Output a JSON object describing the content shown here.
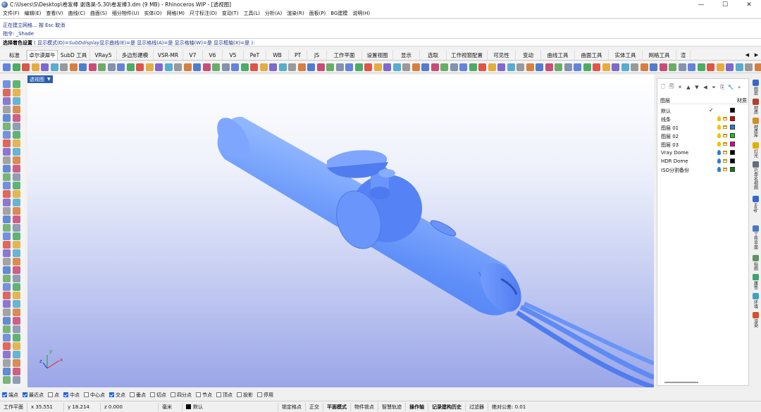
{
  "window": {
    "title": "C:\\Users\\S\\Desktop\\卷发棒 谢逸昊-5.30\\卷发棒3.dm (9 MB) - Rhinoceros WIP - [透视图]",
    "minimize": "—",
    "maximize": "☐",
    "close": "✕"
  },
  "menu": [
    "文件(F)",
    "编辑(E)",
    "查看(V)",
    "曲线(C)",
    "曲面(S)",
    "细分物件(U)",
    "实体(O)",
    "网格(M)",
    "尺寸标注(D)",
    "变动(T)",
    "工具(L)",
    "分析(A)",
    "渲染(R)",
    "面板(P)",
    "BG建模",
    "说明(H)"
  ],
  "command": {
    "history1": "正在建立网格... 按 Esc 取消",
    "history2": "指令: _Shade",
    "prompt_label": "选择着色设置",
    "prompt_opts_a": "( 显示模式(D)=",
    "prompt_mode": "SubDdisplay",
    "prompt_opts_b": " 显示曲线(E)=是 显示格线(A)=是 显示格轴(W)=是 显示框轴(X)=是 ):"
  },
  "tabs": [
    {
      "label": "标准",
      "w": 34
    },
    {
      "label": "卓尔谟犀牛",
      "w": 44,
      "active": true
    },
    {
      "label": "SubD 工具",
      "w": 46
    },
    {
      "label": "VRay5",
      "w": 38
    },
    {
      "label": "多边形建模",
      "w": 52
    },
    {
      "label": "VSR-MR",
      "w": 42
    },
    {
      "label": "V7",
      "w": 28
    },
    {
      "label": "V6",
      "w": 28
    },
    {
      "label": "V5",
      "w": 30
    },
    {
      "label": "PeT",
      "w": 32
    },
    {
      "label": "WB",
      "w": 32
    },
    {
      "label": "PT",
      "w": 26
    },
    {
      "label": "JS",
      "w": 28
    },
    {
      "label": "工作平面",
      "w": 50
    },
    {
      "label": "设置视图",
      "w": 44
    },
    {
      "label": "显示",
      "w": 38
    },
    {
      "label": "选取",
      "w": 38
    },
    {
      "label": "工作视窗配置",
      "w": 58
    },
    {
      "label": "可见性",
      "w": 40
    },
    {
      "label": "变动",
      "w": 36
    },
    {
      "label": "曲线工具",
      "w": 48
    },
    {
      "label": "曲面工具",
      "w": 48
    },
    {
      "label": "实体工具",
      "w": 48
    },
    {
      "label": "网格工具",
      "w": 48
    },
    {
      "label": "渲",
      "w": 20
    }
  ],
  "tab_scroll": {
    "left": "◀",
    "right": "▶"
  },
  "viewport": {
    "label": "透视图",
    "axis_x": "x",
    "axis_y": "y",
    "axis_z": "z"
  },
  "layers_panel": {
    "icons": [
      "🗋",
      "🗐",
      "✕",
      "▲",
      "▼",
      "◀",
      "⏷",
      "⎘",
      "🔧",
      "»"
    ],
    "col_layer": "图层",
    "col_material": "材质",
    "layers": [
      {
        "name": "默认",
        "current": true,
        "check": "✓",
        "bulb": "#f5c000",
        "color": "#000000"
      },
      {
        "name": "线条",
        "bulb": "#f5c000",
        "color": "#e00000"
      },
      {
        "name": "图层 01",
        "bulb": "#f5c000",
        "color": "#1f7fe0"
      },
      {
        "name": "图层 02",
        "bulb": "#f5c000",
        "color": "#19c419"
      },
      {
        "name": "图层 03",
        "bulb": "#f5c000",
        "color": "#e000a0"
      },
      {
        "name": "Vray Dome",
        "bulb": "#2a7de0",
        "color": "#000000"
      },
      {
        "name": "HDR Dome",
        "bulb": "#2a7de0",
        "color": "#000000"
      },
      {
        "name": "ISO分割备份",
        "bulb": "#2a7de0",
        "color": "#0a7d20"
      }
    ]
  },
  "right_tabs": [
    {
      "label": "图层",
      "color": "#3467c8"
    },
    {
      "label": "材质",
      "color": "#b04030"
    },
    {
      "label": "材质库",
      "color": "#d09020"
    },
    {
      "label": "灯光",
      "color": "#e0b000"
    },
    {
      "label": "已命名视图",
      "color": "#607080"
    },
    {
      "label": "Help",
      "color": "#3467c8"
    },
    {
      "label": "工作平面",
      "color": "#4a78c0"
    },
    {
      "label": "贴图",
      "color": "#609060"
    },
    {
      "label": "属性",
      "color": "#40a070"
    },
    {
      "label": "环境",
      "color": "#40a0c0"
    },
    {
      "label": "渲染",
      "color": "#d05030"
    }
  ],
  "osnaps": [
    {
      "label": "端点",
      "on": true
    },
    {
      "label": "最近点",
      "on": true
    },
    {
      "label": "点",
      "on": false
    },
    {
      "label": "中点",
      "on": true
    },
    {
      "label": "中心点",
      "on": false
    },
    {
      "label": "交点",
      "on": true
    },
    {
      "label": "垂点",
      "on": false
    },
    {
      "label": "切点",
      "on": false
    },
    {
      "label": "四分点",
      "on": false
    },
    {
      "label": "节点",
      "on": false
    },
    {
      "label": "顶点",
      "on": false
    },
    {
      "label": "投影",
      "on": false
    },
    {
      "label": "停用",
      "on": false
    }
  ],
  "status": {
    "cplane": "工作平面",
    "x": "x 35.551",
    "y": "y 18.214",
    "z": "z 0.000",
    "unit": "毫米",
    "layer": "默认",
    "grid_snap": "锁定格点",
    "ortho": "正交",
    "planar": "平面模式",
    "osnap": "物件锁点",
    "smarttrack": "智慧轨迹",
    "gumball": "操作轴",
    "history": "记录建构历史",
    "filter": "过滤器",
    "tolerance": "绝对公差: 0.01"
  }
}
